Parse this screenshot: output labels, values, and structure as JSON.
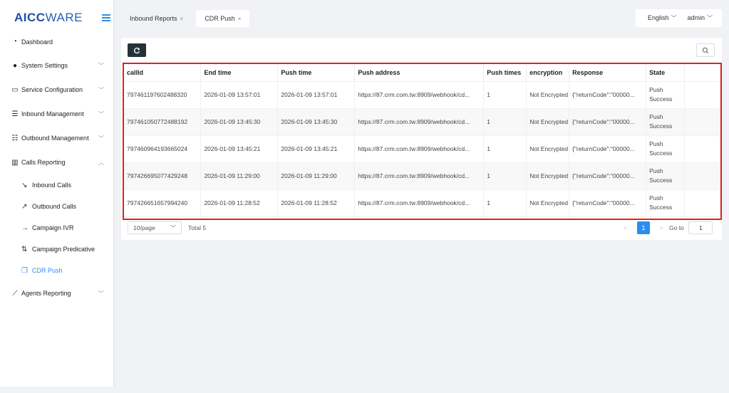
{
  "logo": {
    "part1": "AICC",
    "part2": "WARE"
  },
  "sidebar": {
    "items": [
      {
        "label": "Dashboard",
        "icon": "dashboard-icon"
      },
      {
        "label": "System Settings",
        "icon": "users-icon"
      },
      {
        "label": "Service Configuration",
        "icon": "id-card-icon"
      },
      {
        "label": "Inbound Management",
        "icon": "list-icon"
      },
      {
        "label": "Outbound Management",
        "icon": "grid-list-icon"
      },
      {
        "label": "Calls Reporting",
        "icon": "bar-chart-icon"
      },
      {
        "label": "Agents Reporting",
        "icon": "line-chart-icon"
      }
    ],
    "sub_items": [
      {
        "label": "Inbound Calls",
        "icon": "arrow-down-left-icon"
      },
      {
        "label": "Outbound Calls",
        "icon": "arrow-up-right-icon"
      },
      {
        "label": "Campaign IVR",
        "icon": "arrow-right-icon"
      },
      {
        "label": "Campaign Predicative",
        "icon": "arrows-updown-icon"
      },
      {
        "label": "CDR Push",
        "icon": "copy-icon"
      }
    ]
  },
  "tabs": [
    {
      "label": "Inbound Reports",
      "close": "×"
    },
    {
      "label": "CDR Push",
      "close": "×"
    }
  ],
  "header": {
    "language": "English",
    "user": "admin"
  },
  "table": {
    "columns": [
      "callId",
      "End time",
      "Push time",
      "Push address",
      "Push times",
      "encryption",
      "Response",
      "State"
    ],
    "rows": [
      [
        "797461197602488320",
        "2026-01-09 13:57:01",
        "2026-01-09 13:57:01",
        "https://87.crm.com.tw:8909/webhook/cd...",
        "1",
        "Not Encrypted",
        "{\"returnCode\":\"00000...",
        "Push Success"
      ],
      [
        "797461050772488192",
        "2026-01-09 13:45:30",
        "2026-01-09 13:45:30",
        "https://87.crm.com.tw:8909/webhook/cd...",
        "1",
        "Not Encrypted",
        "{\"returnCode\":\"00000...",
        "Push Success"
      ],
      [
        "797460964193665024",
        "2026-01-09 13:45:21",
        "2026-01-09 13:45:21",
        "https://87.crm.com.tw:8909/webhook/cd...",
        "1",
        "Not Encrypted",
        "{\"returnCode\":\"00000...",
        "Push Success"
      ],
      [
        "797426695077429248",
        "2026-01-09 11:29:00",
        "2026-01-09 11:29:00",
        "https://87.crm.com.tw:8909/webhook/cd...",
        "1",
        "Not Encrypted",
        "{\"returnCode\":\"00000...",
        "Push Success"
      ],
      [
        "797426651657994240",
        "2026-01-09 11:28:52",
        "2026-01-09 11:28:52",
        "https://87.crm.com.tw:8909/webhook/cd...",
        "1",
        "Not Encrypted",
        "{\"returnCode\":\"00000...",
        "Push Success"
      ]
    ]
  },
  "pagination": {
    "page_size": "10/page",
    "total": "Total 5",
    "prev": "<",
    "current": "1",
    "next": ">",
    "goto_label": "Go to",
    "goto_value": "1"
  },
  "colors": {
    "accent": "#2d8cf0",
    "highlight_border": "#e02020",
    "dark_button": "#263238"
  }
}
